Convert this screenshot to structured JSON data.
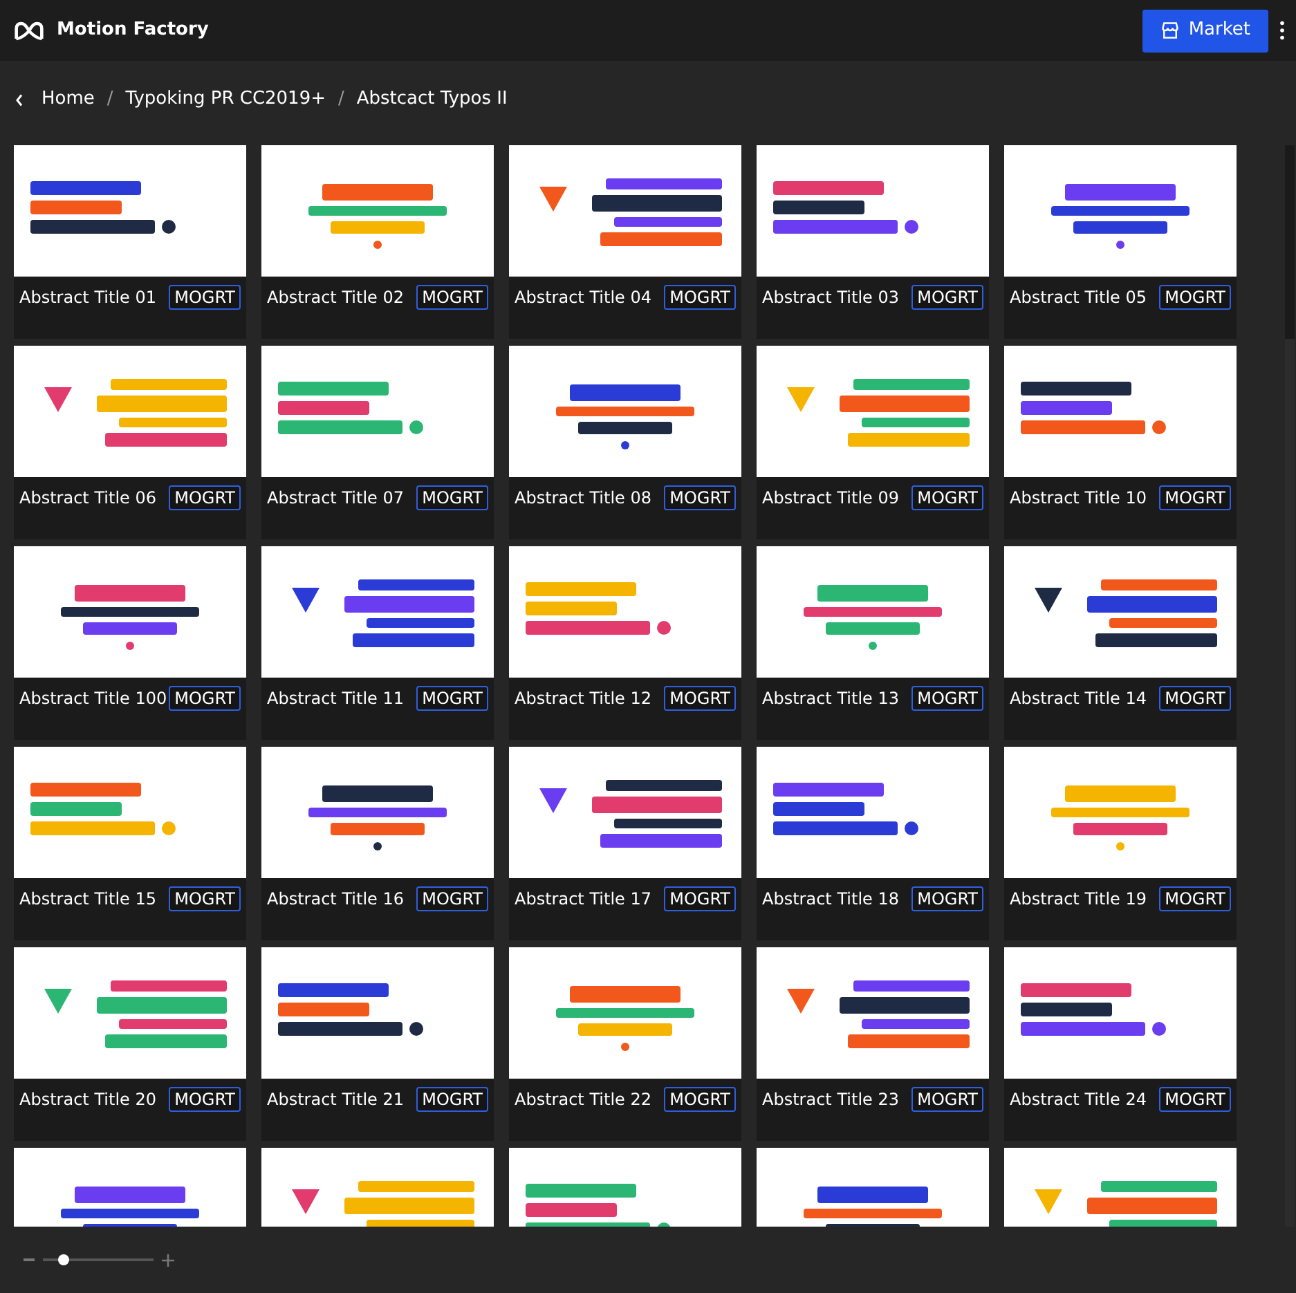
{
  "app": {
    "title": "Motion Factory"
  },
  "market_button": {
    "label": "Market"
  },
  "breadcrumb": [
    {
      "kind": "link",
      "text": "Home"
    },
    {
      "kind": "separator",
      "text": "/"
    },
    {
      "kind": "link",
      "text": "Typoking PR CC2019+"
    },
    {
      "kind": "separator",
      "text": "/"
    },
    {
      "kind": "link",
      "text": "Abstcact Typos II"
    }
  ],
  "cards": [
    {
      "kind": "template",
      "title": "Abstract Title 01",
      "badge": "MOGRT"
    },
    {
      "kind": "template",
      "title": "Abstract Title 02",
      "badge": "MOGRT"
    },
    {
      "kind": "template",
      "title": "Abstract Title 04",
      "badge": "MOGRT"
    },
    {
      "kind": "template",
      "title": "Abstract Title 03",
      "badge": "MOGRT"
    },
    {
      "kind": "template",
      "title": "Abstract Title 05",
      "badge": "MOGRT"
    },
    {
      "kind": "template",
      "title": "Abstract Title 06",
      "badge": "MOGRT"
    },
    {
      "kind": "template",
      "title": "Abstract Title 07",
      "badge": "MOGRT"
    },
    {
      "kind": "template",
      "title": "Abstract Title 08",
      "badge": "MOGRT"
    },
    {
      "kind": "template",
      "title": "Abstract Title 09",
      "badge": "MOGRT"
    },
    {
      "kind": "template",
      "title": "Abstract Title 10",
      "badge": "MOGRT"
    },
    {
      "kind": "template",
      "title": "Abstract Title 100",
      "badge": "MOGRT"
    },
    {
      "kind": "template",
      "title": "Abstract Title 11",
      "badge": "MOGRT"
    },
    {
      "kind": "template",
      "title": "Abstract Title 12",
      "badge": "MOGRT"
    },
    {
      "kind": "template",
      "title": "Abstract Title 13",
      "badge": "MOGRT"
    },
    {
      "kind": "template",
      "title": "Abstract Title 14",
      "badge": "MOGRT"
    },
    {
      "kind": "template",
      "title": "Abstract Title 15",
      "badge": "MOGRT"
    },
    {
      "kind": "template",
      "title": "Abstract Title 16",
      "badge": "MOGRT"
    },
    {
      "kind": "template",
      "title": "Abstract Title 17",
      "badge": "MOGRT"
    },
    {
      "kind": "template",
      "title": "Abstract Title 18",
      "badge": "MOGRT"
    },
    {
      "kind": "template",
      "title": "Abstract Title 19",
      "badge": "MOGRT"
    },
    {
      "kind": "template",
      "title": "Abstract Title 20",
      "badge": "MOGRT"
    },
    {
      "kind": "template",
      "title": "Abstract Title 21",
      "badge": "MOGRT"
    },
    {
      "kind": "template",
      "title": "Abstract Title 22",
      "badge": "MOGRT"
    },
    {
      "kind": "template",
      "title": "Abstract Title 23",
      "badge": "MOGRT"
    },
    {
      "kind": "template",
      "title": "Abstract Title 24",
      "badge": "MOGRT"
    },
    {
      "kind": "picture"
    },
    {
      "kind": "picture"
    },
    {
      "kind": "picture"
    },
    {
      "kind": "picture"
    },
    {
      "kind": "picture"
    }
  ],
  "zoom_slider": {
    "level": 0.19
  }
}
